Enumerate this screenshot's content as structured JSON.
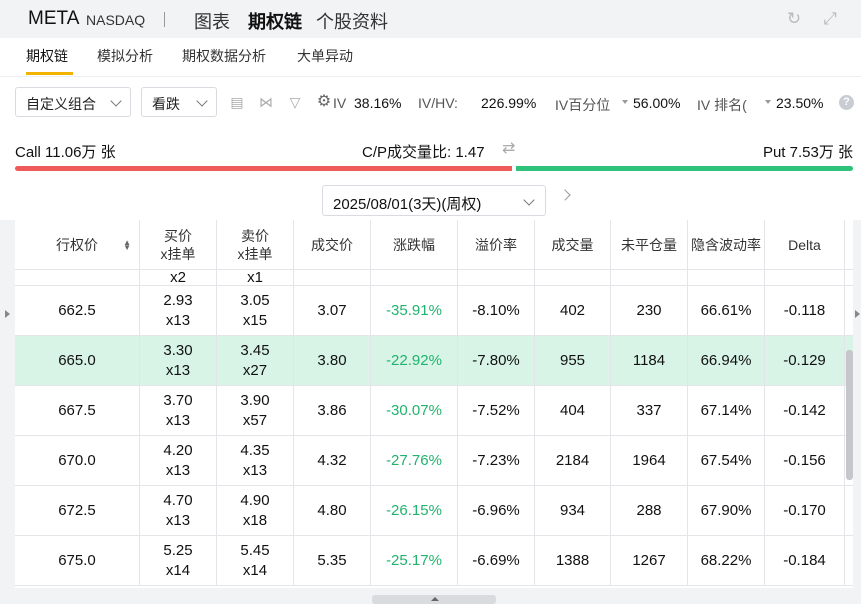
{
  "header": {
    "ticker": "META",
    "exchange": "NASDAQ",
    "tabs": [
      "图表",
      "期权链",
      "个股资料"
    ],
    "active_tab": "期权链"
  },
  "subtabs": [
    "期权链",
    "模拟分析",
    "期权数据分析",
    "大单异动"
  ],
  "toolbar": {
    "combo_select": "自定义组合",
    "direction_select": "看跌",
    "iv_label": "IV",
    "iv_value": "38.16%",
    "ivhv_label": "IV/HV:",
    "ivhv_value": "226.99%",
    "iv_pct_label": "IV百分位",
    "iv_pct_value": "56.00%",
    "iv_rank_label": "IV 排名(",
    "iv_rank_value": "23.50%",
    "help": "?"
  },
  "cp": {
    "call_text": "Call 11.06万 张",
    "ratio_text": "C/P成交量比:  1.47",
    "put_text": "Put 7.53万 张",
    "call_share": 0.595,
    "call_color": "#ef5b5b",
    "put_color": "#2fc27a"
  },
  "expiry": {
    "date": "2025/08/01(3天)(周权)"
  },
  "table": {
    "headers": [
      "行权价",
      "买价\nx挂单",
      "卖价\nx挂单",
      "成交价",
      "涨跌幅",
      "溢价率",
      "成交量",
      "未平仓量",
      "隐含波动率",
      "Delta"
    ],
    "partial_row": [
      "",
      "x2",
      "x1",
      "",
      "",
      "",
      "",
      "",
      "",
      ""
    ],
    "rows": [
      {
        "strike": "662.5",
        "bid": "2.93",
        "bid_size": "x13",
        "ask": "3.05",
        "ask_size": "x15",
        "last": "3.07",
        "change": "-35.91%",
        "premium": "-8.10%",
        "volume": "402",
        "oi": "230",
        "iv": "66.61%",
        "delta": "-0.118",
        "selected": false
      },
      {
        "strike": "665.0",
        "bid": "3.30",
        "bid_size": "x13",
        "ask": "3.45",
        "ask_size": "x27",
        "last": "3.80",
        "change": "-22.92%",
        "premium": "-7.80%",
        "volume": "955",
        "oi": "1184",
        "iv": "66.94%",
        "delta": "-0.129",
        "selected": true
      },
      {
        "strike": "667.5",
        "bid": "3.70",
        "bid_size": "x13",
        "ask": "3.90",
        "ask_size": "x57",
        "last": "3.86",
        "change": "-30.07%",
        "premium": "-7.52%",
        "volume": "404",
        "oi": "337",
        "iv": "67.14%",
        "delta": "-0.142",
        "selected": false
      },
      {
        "strike": "670.0",
        "bid": "4.20",
        "bid_size": "x13",
        "ask": "4.35",
        "ask_size": "x13",
        "last": "4.32",
        "change": "-27.76%",
        "premium": "-7.23%",
        "volume": "2184",
        "oi": "1964",
        "iv": "67.54%",
        "delta": "-0.156",
        "selected": false
      },
      {
        "strike": "672.5",
        "bid": "4.70",
        "bid_size": "x13",
        "ask": "4.90",
        "ask_size": "x18",
        "last": "4.80",
        "change": "-26.15%",
        "premium": "-6.96%",
        "volume": "934",
        "oi": "288",
        "iv": "67.90%",
        "delta": "-0.170",
        "selected": false
      },
      {
        "strike": "675.0",
        "bid": "5.25",
        "bid_size": "x14",
        "ask": "5.45",
        "ask_size": "x14",
        "last": "5.35",
        "change": "-25.17%",
        "premium": "-6.69%",
        "volume": "1388",
        "oi": "1267",
        "iv": "68.22%",
        "delta": "-0.184",
        "selected": false
      }
    ]
  }
}
